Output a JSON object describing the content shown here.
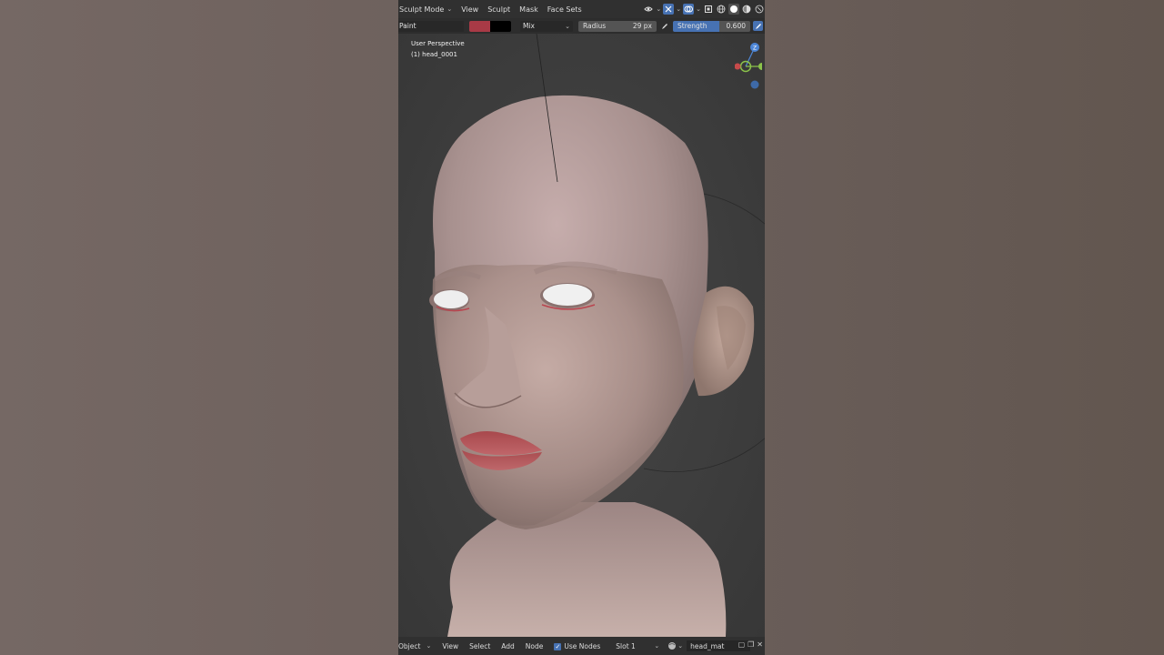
{
  "header": {
    "mode_label": "Sculpt Mode",
    "menus": [
      "View",
      "Sculpt",
      "Mask",
      "Face Sets"
    ]
  },
  "tool_settings": {
    "brush_name": "Paint",
    "primary_color": "#a83a46",
    "secondary_color": "#000000",
    "blend_mode": "Mix",
    "radius_label": "Radius",
    "radius_value": "29 px",
    "strength_label": "Strength",
    "strength_value": "0.600",
    "strength_fraction": 0.6
  },
  "viewport": {
    "view_name": "User Perspective",
    "object_name": "(1) head_0001",
    "gizmo_axes": {
      "z_color": "#4d86d6",
      "y_color": "#8bc34a",
      "x_color": "#c64a4a"
    }
  },
  "footer": {
    "object_label": "Object",
    "menus": [
      "View",
      "Select",
      "Add",
      "Node"
    ],
    "use_nodes_label": "Use Nodes",
    "use_nodes_checked": true,
    "slot_label": "Slot 1",
    "material_name": "head_mat"
  },
  "icons": {
    "accent": "#4772b3"
  }
}
